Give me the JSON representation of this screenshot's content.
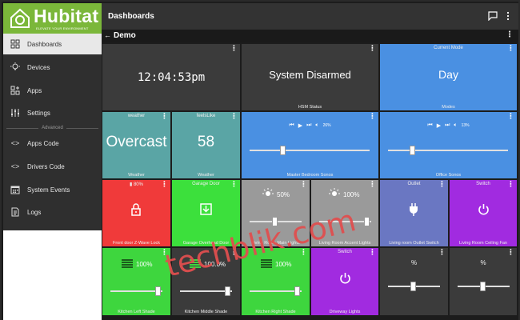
{
  "app": {
    "brand": "Hubitat",
    "tagline": "ELEVATE YOUR ENVIRONMENT",
    "brand_color": "#7bb73a"
  },
  "sidebar": {
    "items": [
      {
        "label": "Dashboards",
        "icon": "dashboard-icon",
        "active": true
      },
      {
        "label": "Devices",
        "icon": "lightbulb-icon"
      },
      {
        "label": "Apps",
        "icon": "apps-icon"
      },
      {
        "label": "Settings",
        "icon": "sliders-icon"
      }
    ],
    "section_label": "Advanced",
    "advanced_items": [
      {
        "label": "Apps Code",
        "icon": "code-icon"
      },
      {
        "label": "Drivers Code",
        "icon": "code-icon"
      },
      {
        "label": "System Events",
        "icon": "calendar-icon"
      },
      {
        "label": "Logs",
        "icon": "document-icon"
      }
    ]
  },
  "header": {
    "title": "Dashboards"
  },
  "dashboard": {
    "back": "←",
    "title": "Demo",
    "menu": "⋮"
  },
  "tiles": {
    "clock": {
      "value": "12:04:53pm",
      "label": ""
    },
    "hsm": {
      "value": "System Disarmed",
      "label": "HSM Status"
    },
    "mode": {
      "top": "Current Mode",
      "value": "Day",
      "label": "Modes"
    },
    "weather": {
      "top": "weather",
      "value": "Overcast",
      "label": "Weather"
    },
    "feels": {
      "top": "feelsLike",
      "value": "58",
      "label": "Weather"
    },
    "sonos1": {
      "volume": "26%",
      "label": "Master Bedroom Sonos",
      "level": 0.26
    },
    "sonos2": {
      "volume": "13%",
      "label": "Office Sonos",
      "level": 0.2
    },
    "lock": {
      "battery": "80%",
      "label": "Front door Z-Wave Lock"
    },
    "garage": {
      "top": "Garage Door",
      "label": "Garage Overhead Door"
    },
    "lr_main": {
      "percent": "50%",
      "label": "Living Room Main Lights",
      "level": 0.5
    },
    "lr_accent": {
      "percent": "100%",
      "label": "Living Room Accent Lights",
      "level": 1.0
    },
    "outlet": {
      "top": "Outlet",
      "label": "Living room Outlet Switch"
    },
    "fan": {
      "top": "Switch",
      "label": "Living Room Ceiling Fan"
    },
    "shade_left": {
      "percent": "100%",
      "label": "Kitchen Left Shade",
      "level": 1.0
    },
    "shade_middle": {
      "percent": "100.0%",
      "label": "Kitchen Middle Shade",
      "level": 1.0
    },
    "shade_right": {
      "percent": "100%",
      "label": "Kitchen Right Shade",
      "level": 1.0
    },
    "driveway": {
      "top": "Switch",
      "label": "Driveway Lights"
    },
    "dim1": {
      "top": "%",
      "level": 0.5
    },
    "dim2": {
      "top": "%",
      "level": 0.5
    }
  },
  "colors": {
    "dark_tile": "#3b3b3b",
    "blue_tile": "#4a90e2",
    "teal_tile": "#5aa5a5",
    "red_tile": "#f03a3a",
    "green_tile": "#3ce03c",
    "gray_tile": "#9a9a9a",
    "slate_tile": "#6a77c2",
    "purple_tile": "#a12be0",
    "bright_green": "#3ed63e"
  },
  "watermark": "techblik.com"
}
